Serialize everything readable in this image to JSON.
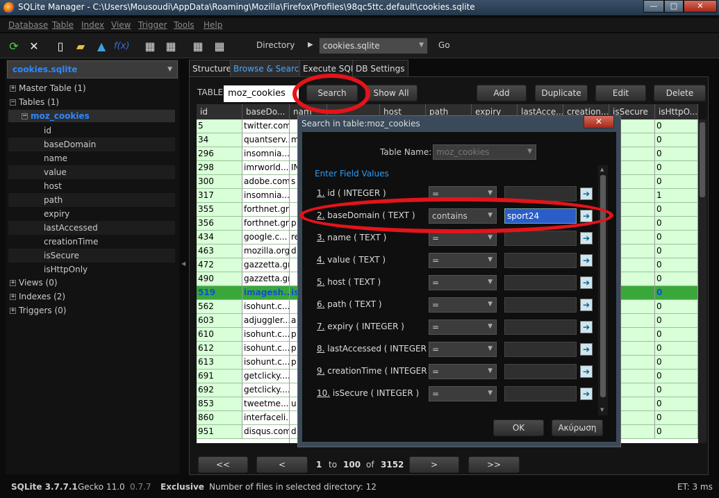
{
  "window": {
    "title": "SQLite Manager - C:\\Users\\Mousoudi\\AppData\\Roaming\\Mozilla\\Firefox\\Profiles\\98qc5ttc.default\\cookies.sqlite",
    "min": "—",
    "max": "□",
    "close": "✕"
  },
  "menu": [
    "Database",
    "Table",
    "Index",
    "View",
    "Trigger",
    "Tools",
    "Help"
  ],
  "toolbar": {
    "directory_label": "Directory",
    "directory_value": "cookies.sqlite",
    "go_label": "Go",
    "fx_label": "f(x)"
  },
  "sidebar": {
    "db": "cookies.sqlite",
    "master_table": "Master Table (1)",
    "tables": "Tables (1)",
    "table": "moz_cookies",
    "columns": [
      "id",
      "baseDomain",
      "name",
      "value",
      "host",
      "path",
      "expiry",
      "lastAccessed",
      "creationTime",
      "isSecure",
      "isHttpOnly"
    ],
    "views": "Views (0)",
    "indexes": "Indexes (2)",
    "triggers": "Triggers (0)"
  },
  "tabs": [
    "Structure",
    "Browse & Search",
    "Execute SQL",
    "DB Settings"
  ],
  "browse": {
    "table_label": "TABLE",
    "table_value": "moz_cookies",
    "search": "Search",
    "show_all": "Show All",
    "add": "Add",
    "duplicate": "Duplicate",
    "edit": "Edit",
    "delete": "Delete",
    "headers": [
      "id",
      "baseDo...",
      "nam",
      "",
      "host",
      "path",
      "expiry",
      "lastAcce...",
      "creation...",
      "isSecure",
      "isHttpO..."
    ],
    "rows": [
      {
        "id": "5",
        "domain": "twitter.com",
        "name": "",
        "http": "0"
      },
      {
        "id": "34",
        "domain": "quantserv...",
        "name": "m",
        "http": "0"
      },
      {
        "id": "296",
        "domain": "insomnia....",
        "name": "",
        "http": "0"
      },
      {
        "id": "298",
        "domain": "imrworld....",
        "name": "IN",
        "http": "0"
      },
      {
        "id": "300",
        "domain": "adobe.com",
        "name": "s",
        "http": "0"
      },
      {
        "id": "317",
        "domain": "insomnia....",
        "name": "",
        "http": "1"
      },
      {
        "id": "355",
        "domain": "forthnet.gr",
        "name": "",
        "http": "0"
      },
      {
        "id": "356",
        "domain": "forthnet.gr",
        "name": "p",
        "http": "0"
      },
      {
        "id": "434",
        "domain": "google.c...",
        "name": "re",
        "http": "0"
      },
      {
        "id": "463",
        "domain": "mozilla.org",
        "name": "d",
        "http": "0"
      },
      {
        "id": "472",
        "domain": "gazzetta.gr",
        "name": "",
        "http": "0"
      },
      {
        "id": "490",
        "domain": "gazzetta.gr",
        "name": "",
        "http": "0"
      },
      {
        "id": "519",
        "domain": "imagesh...",
        "name": "is",
        "http": "0"
      },
      {
        "id": "562",
        "domain": "isohunt.c...",
        "name": "",
        "http": "0"
      },
      {
        "id": "603",
        "domain": "adjuggler....",
        "name": "a",
        "http": "0"
      },
      {
        "id": "610",
        "domain": "isohunt.c...",
        "name": "p",
        "http": "0"
      },
      {
        "id": "612",
        "domain": "isohunt.c...",
        "name": "p",
        "http": "0"
      },
      {
        "id": "613",
        "domain": "isohunt.c...",
        "name": "p",
        "http": "0"
      },
      {
        "id": "691",
        "domain": "getclicky....",
        "name": "",
        "http": "0"
      },
      {
        "id": "692",
        "domain": "getclicky....",
        "name": "",
        "http": "0"
      },
      {
        "id": "853",
        "domain": "tweetme...",
        "name": "u",
        "http": "0"
      },
      {
        "id": "860",
        "domain": "interfaceli...",
        "name": "",
        "http": "0"
      },
      {
        "id": "951",
        "domain": "disqus.com",
        "name": "d",
        "http": "0"
      }
    ],
    "pager": {
      "prevprev": "<<",
      "prev": "<",
      "from": "1",
      "to": "to",
      "end": "100",
      "of": "of",
      "total": "3152",
      "next": ">",
      "nextnext": ">>"
    }
  },
  "dialog": {
    "title": "Search in table:moz_cookies",
    "close": "✕",
    "table_name_label": "Table Name:",
    "table_name_value": "moz_cookies",
    "enter_field_values": "Enter Field Values",
    "fields": [
      {
        "num": "1.",
        "label": " id ( INTEGER )",
        "op": "=",
        "value": ""
      },
      {
        "num": "2.",
        "label": " baseDomain ( TEXT )",
        "op": "contains",
        "value": "sport24"
      },
      {
        "num": "3.",
        "label": " name ( TEXT )",
        "op": "=",
        "value": ""
      },
      {
        "num": "4.",
        "label": " value ( TEXT )",
        "op": "=",
        "value": ""
      },
      {
        "num": "5.",
        "label": " host ( TEXT )",
        "op": "=",
        "value": ""
      },
      {
        "num": "6.",
        "label": " path ( TEXT )",
        "op": "=",
        "value": ""
      },
      {
        "num": "7.",
        "label": " expiry ( INTEGER )",
        "op": "=",
        "value": ""
      },
      {
        "num": "8.",
        "label": " lastAccessed ( INTEGER )",
        "op": "=",
        "value": ""
      },
      {
        "num": "9.",
        "label": " creationTime ( INTEGER )",
        "op": "=",
        "value": ""
      },
      {
        "num": "10.",
        "label": " isSecure ( INTEGER )",
        "op": "=",
        "value": ""
      }
    ],
    "ok": "OK",
    "cancel": "Ακύρωση"
  },
  "status": {
    "sqlite": "SQLite 3.7.7.1",
    "gecko": "Gecko 11.0",
    "version": "0.7.7",
    "mode": "Exclusive",
    "files": "Number of files in selected directory: 12",
    "et": "ET: 3 ms"
  },
  "colors": {
    "accent_blue": "#2d89ff",
    "row_green": "#d8ffd8",
    "highlight_red": "#e4141a"
  }
}
